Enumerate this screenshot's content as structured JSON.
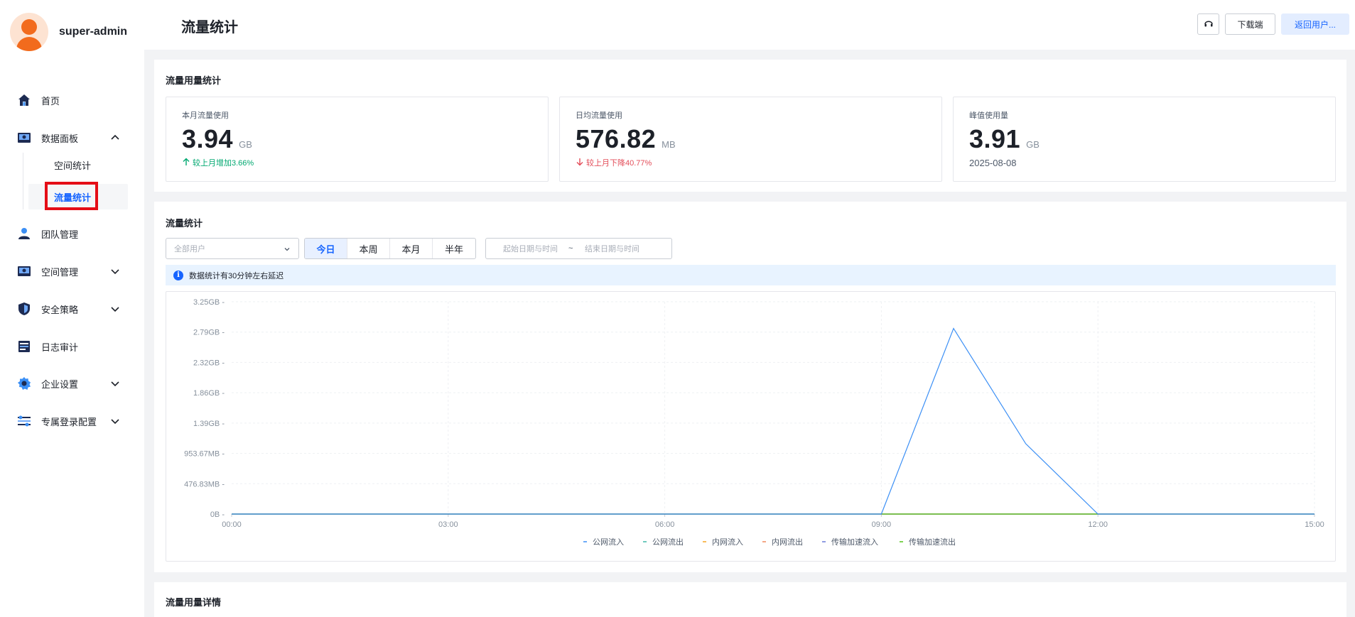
{
  "sidebar": {
    "username": "super-admin",
    "items": [
      {
        "label": "首页",
        "icon": "home-icon"
      },
      {
        "label": "数据面板",
        "icon": "dashboard-icon",
        "expanded": true
      },
      {
        "label": "团队管理",
        "icon": "team-icon"
      },
      {
        "label": "空间管理",
        "icon": "space-icon"
      },
      {
        "label": "安全策略",
        "icon": "shield-icon"
      },
      {
        "label": "日志审计",
        "icon": "log-icon"
      },
      {
        "label": "企业设置",
        "icon": "gear-icon"
      },
      {
        "label": "专属登录配置",
        "icon": "sliders-icon"
      }
    ],
    "subitems": [
      {
        "label": "空间统计"
      },
      {
        "label": "流量统计",
        "active": true
      }
    ]
  },
  "header": {
    "title": "流量统计",
    "download_label": "下载端",
    "return_label": "返回用户..."
  },
  "usage": {
    "title": "流量用量统计",
    "cards": [
      {
        "label": "本月流量使用",
        "value": "3.94",
        "unit": "GB",
        "trend": "较上月增加3.66%",
        "direction": "up"
      },
      {
        "label": "日均流量使用",
        "value": "576.82",
        "unit": "MB",
        "trend": "较上月下降40.77%",
        "direction": "down"
      },
      {
        "label": "峰值使用量",
        "value": "3.91",
        "unit": "GB",
        "date": "2025-08-08"
      }
    ]
  },
  "traffic": {
    "title": "流量统计",
    "user_select_placeholder": "全部用户",
    "periods": [
      "今日",
      "本周",
      "本月",
      "半年"
    ],
    "active_period": "今日",
    "date_start_placeholder": "起始日期与时间",
    "date_separator": "~",
    "date_end_placeholder": "结束日期与时间",
    "notice": "数据统计有30分钟左右延迟"
  },
  "chart_data": {
    "type": "line",
    "title": "",
    "xlabel": "",
    "ylabel": "",
    "x": [
      "00:00",
      "01:00",
      "02:00",
      "03:00",
      "04:00",
      "05:00",
      "06:00",
      "07:00",
      "08:00",
      "09:00",
      "10:00",
      "11:00",
      "12:00",
      "13:00",
      "14:00",
      "15:00"
    ],
    "x_ticks": [
      "00:00",
      "03:00",
      "06:00",
      "09:00",
      "12:00",
      "15:00"
    ],
    "y_ticks": [
      "0B",
      "476.83MB",
      "953.67MB",
      "1.39GB",
      "1.86GB",
      "2.32GB",
      "2.79GB",
      "3.25GB"
    ],
    "ylim_bytes": [
      0,
      3500000000
    ],
    "grid": true,
    "legend_position": "bottom",
    "series": [
      {
        "name": "公网流入",
        "color": "#3b8ff5",
        "values": [
          0,
          0,
          0,
          0,
          0,
          0,
          0,
          0,
          0,
          0,
          3060000000,
          1160000000,
          0,
          0,
          0,
          0
        ]
      },
      {
        "name": "公网流出",
        "color": "#3fb8a8",
        "values": [
          0,
          0,
          0,
          0,
          0,
          0,
          0,
          0,
          0,
          0,
          0,
          0,
          0,
          0,
          0,
          0
        ]
      },
      {
        "name": "内网流入",
        "color": "#f5a623",
        "values": [
          0,
          0,
          0,
          0,
          0,
          0,
          0,
          0,
          0,
          0,
          0,
          0,
          0,
          0,
          0,
          0
        ]
      },
      {
        "name": "内网流出",
        "color": "#f08a5d",
        "values": [
          0,
          0,
          0,
          0,
          0,
          0,
          0,
          0,
          0,
          0,
          0,
          0,
          0,
          0,
          0,
          0
        ]
      },
      {
        "name": "传输加速流入",
        "color": "#6b7bd9",
        "values": [
          0,
          0,
          0,
          0,
          0,
          0,
          0,
          0,
          0,
          0,
          0,
          0,
          0,
          0,
          0,
          0
        ]
      },
      {
        "name": "传输加速流出",
        "color": "#52c41a",
        "values": [
          0,
          0,
          0,
          0,
          0,
          0,
          0,
          0,
          0,
          0,
          0,
          0,
          0,
          0,
          0,
          0
        ]
      }
    ]
  },
  "details": {
    "title": "流量用量详情"
  }
}
